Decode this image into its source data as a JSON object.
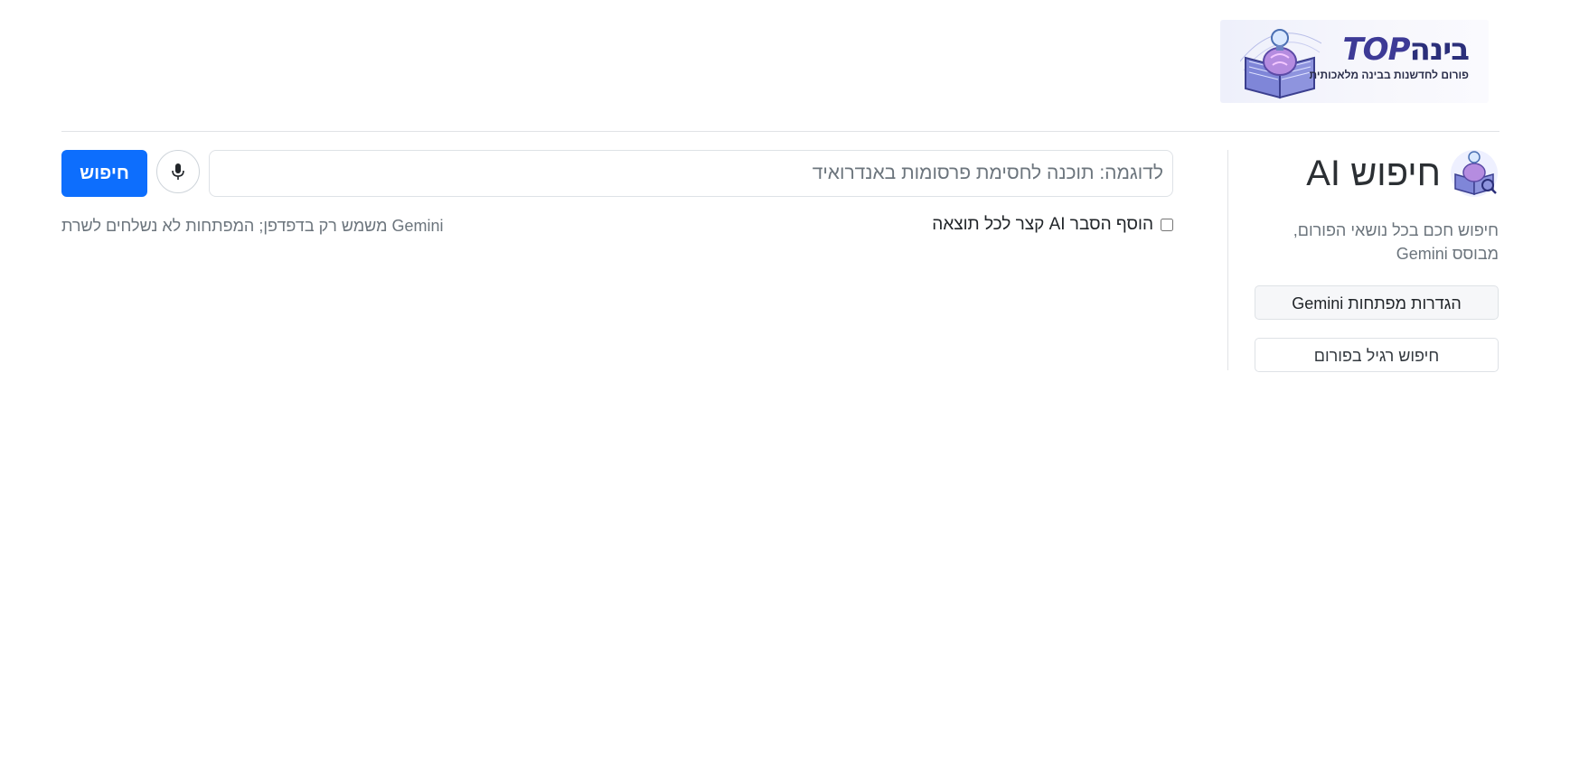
{
  "header": {
    "logo_title_hebrew": "בינה",
    "logo_title_top": "TOP",
    "logo_subtitle": "פורום לחדשנות בבינה מלאכותית"
  },
  "sidebar": {
    "title": "חיפוש AI",
    "description": "חיפוש חכם בכל נושאי הפורום, מבוסס Gemini",
    "settings_button": "הגדרות מפתחות Gemini",
    "regular_search_button": "חיפוש רגיל בפורום"
  },
  "search": {
    "placeholder": "לדוגמה: תוכנה לחסימת פרסומות באנדרואיד",
    "value": "",
    "button_label": "חיפוש",
    "mic_icon": "microphone-icon",
    "ai_explain_label": "הוסף הסבר AI קצר לכל תוצאה",
    "ai_explain_checked": false,
    "privacy_note": "Gemini משמש רק בדפדפן; המפתחות לא נשלחים לשרת"
  },
  "colors": {
    "primary": "#0d6efd",
    "muted_text": "#6c757d",
    "border": "#dee2e6"
  }
}
